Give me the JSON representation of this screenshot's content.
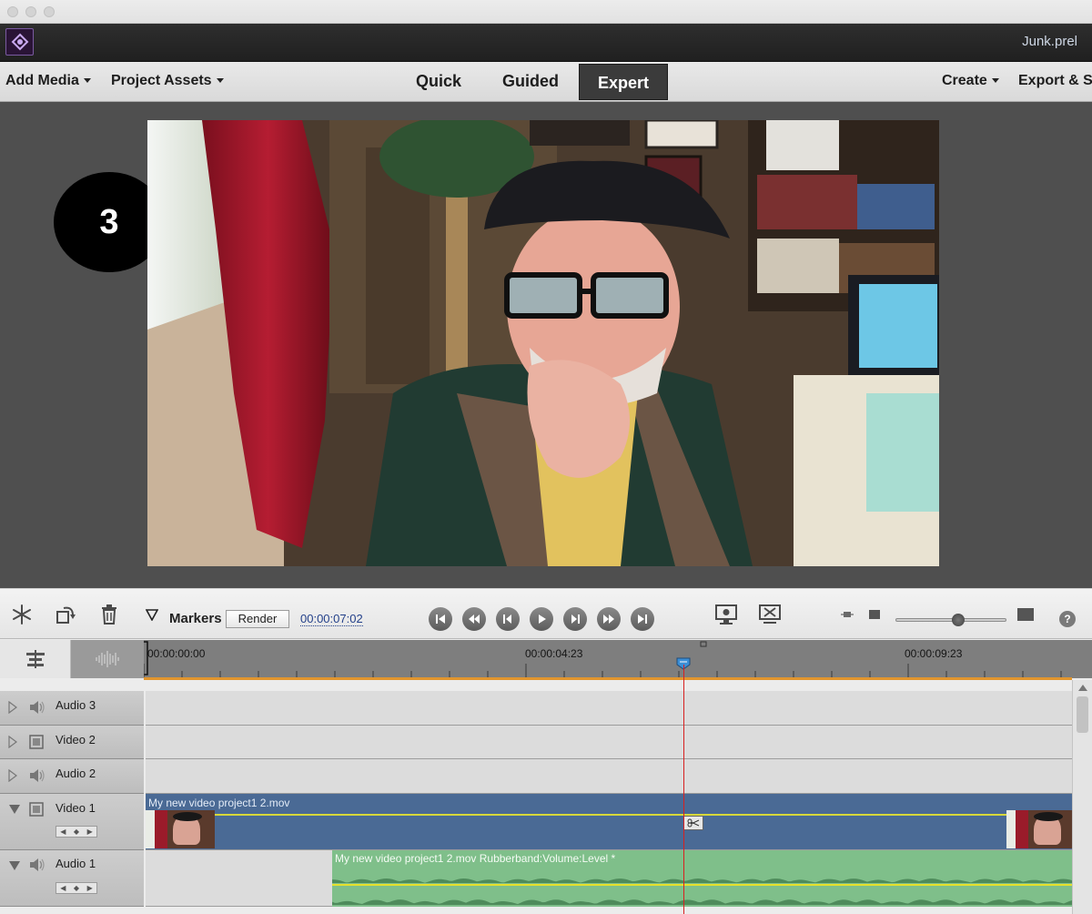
{
  "window": {
    "filename": "Junk.prel"
  },
  "menubar": {
    "add_media": "Add Media",
    "project_assets": "Project Assets",
    "modes": [
      "Quick",
      "Guided",
      "Expert"
    ],
    "active_mode": "Expert",
    "create": "Create",
    "export_share": "Export & S"
  },
  "monitor": {
    "step_badge": "3"
  },
  "toolbar": {
    "markers_label": "Markers",
    "render_label": "Render",
    "timecode": "00:00:07:02"
  },
  "ruler": {
    "times": [
      "00:00:00:00",
      "00:00:04:23",
      "00:00:09:23"
    ]
  },
  "tracks": [
    {
      "name": "Audio 3",
      "kind": "audio"
    },
    {
      "name": "Video 2",
      "kind": "video"
    },
    {
      "name": "Audio 2",
      "kind": "audio"
    },
    {
      "name": "Video 1",
      "kind": "video",
      "clip": "My new video project1 2.mov"
    },
    {
      "name": "Audio 1",
      "kind": "audio",
      "clip": "My new video project1 2.mov Rubberband:Volume:Level *"
    }
  ],
  "help": "?",
  "colors": {
    "video_clip": "#4a6a95",
    "audio_clip": "#7fbf8a",
    "playhead": "#d82020",
    "work_area": "#e1952e"
  }
}
